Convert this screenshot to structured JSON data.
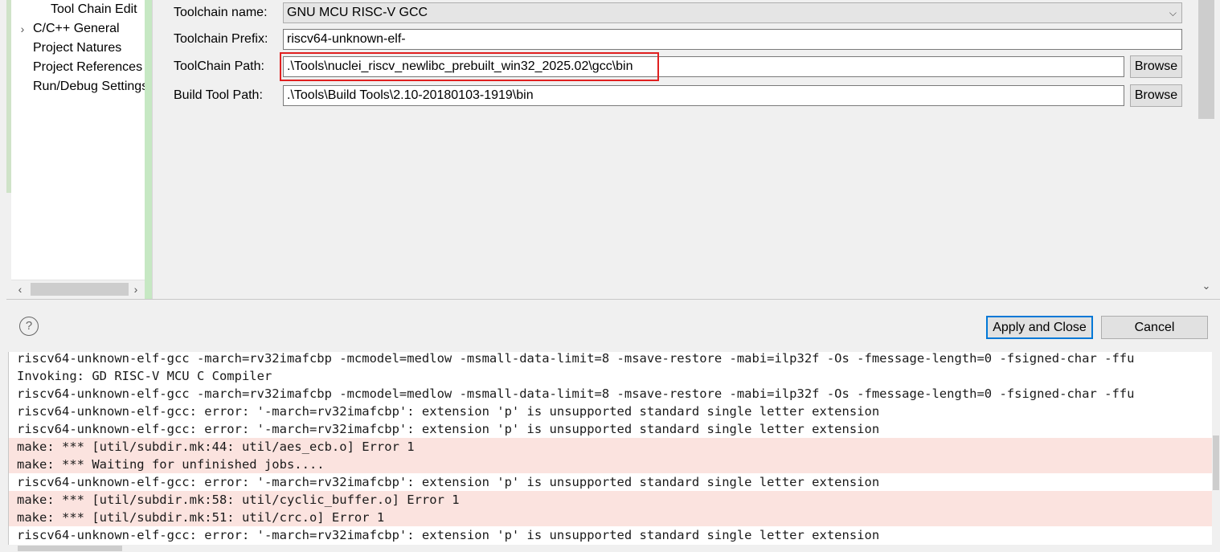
{
  "nav_tree": {
    "items": [
      {
        "label": "Tool Chain Edit",
        "has_expander": false
      },
      {
        "label": "C/C++ General",
        "has_expander": true
      },
      {
        "label": "Project Natures",
        "has_expander": false
      },
      {
        "label": "Project References",
        "has_expander": false
      },
      {
        "label": "Run/Debug Settings",
        "has_expander": false
      }
    ],
    "expander_glyph": "›",
    "scroll_left": "‹",
    "scroll_right": "›"
  },
  "form": {
    "toolchain_name_label": "Toolchain name:",
    "toolchain_name_value": "GNU MCU RISC-V GCC",
    "toolchain_prefix_label": "Toolchain Prefix:",
    "toolchain_prefix_value": "riscv64-unknown-elf-",
    "toolchain_path_label": "ToolChain Path:",
    "toolchain_path_value": ".\\Tools\\nuclei_riscv_newlibc_prebuilt_win32_2025.02\\gcc\\bin",
    "build_tool_path_label": "Build Tool Path:",
    "build_tool_path_value": ".\\Tools\\Build Tools\\2.10-20180103-1919\\bin",
    "browse_label": "Browse",
    "highlight_color": "#e02020"
  },
  "dialog": {
    "help_glyph": "?",
    "apply_close_label": "Apply and Close",
    "cancel_label": "Cancel",
    "default_button_color": "#0078d7"
  },
  "console": {
    "error_highlight_color": "#fbe3df",
    "lines": [
      {
        "text": "riscv64-unknown-elf-gcc -march=rv32imafcbp -mcmodel=medlow -msmall-data-limit=8 -msave-restore -mabi=ilp32f -Os -fmessage-length=0 -fsigned-char -ffu",
        "error": false
      },
      {
        "text": "Invoking: GD RISC-V MCU C Compiler",
        "error": false
      },
      {
        "text": "riscv64-unknown-elf-gcc -march=rv32imafcbp -mcmodel=medlow -msmall-data-limit=8 -msave-restore -mabi=ilp32f -Os -fmessage-length=0 -fsigned-char -ffu",
        "error": false
      },
      {
        "text": "riscv64-unknown-elf-gcc: error: '-march=rv32imafcbp': extension 'p' is unsupported standard single letter extension",
        "error": false
      },
      {
        "text": "riscv64-unknown-elf-gcc: error: '-march=rv32imafcbp': extension 'p' is unsupported standard single letter extension",
        "error": false
      },
      {
        "text": "make: *** [util/subdir.mk:44: util/aes_ecb.o] Error 1",
        "error": true
      },
      {
        "text": "make: *** Waiting for unfinished jobs....",
        "error": true
      },
      {
        "text": "riscv64-unknown-elf-gcc: error: '-march=rv32imafcbp': extension 'p' is unsupported standard single letter extension",
        "error": false
      },
      {
        "text": "make: *** [util/subdir.mk:58: util/cyclic_buffer.o] Error 1",
        "error": true
      },
      {
        "text": "make: *** [util/subdir.mk:51: util/crc.o] Error 1",
        "error": true
      },
      {
        "text": "riscv64-unknown-elf-gcc: error: '-march=rv32imafcbp': extension 'p' is unsupported standard single letter extension",
        "error": false
      }
    ]
  },
  "scroll_glyphs": {
    "down": "⌄"
  }
}
